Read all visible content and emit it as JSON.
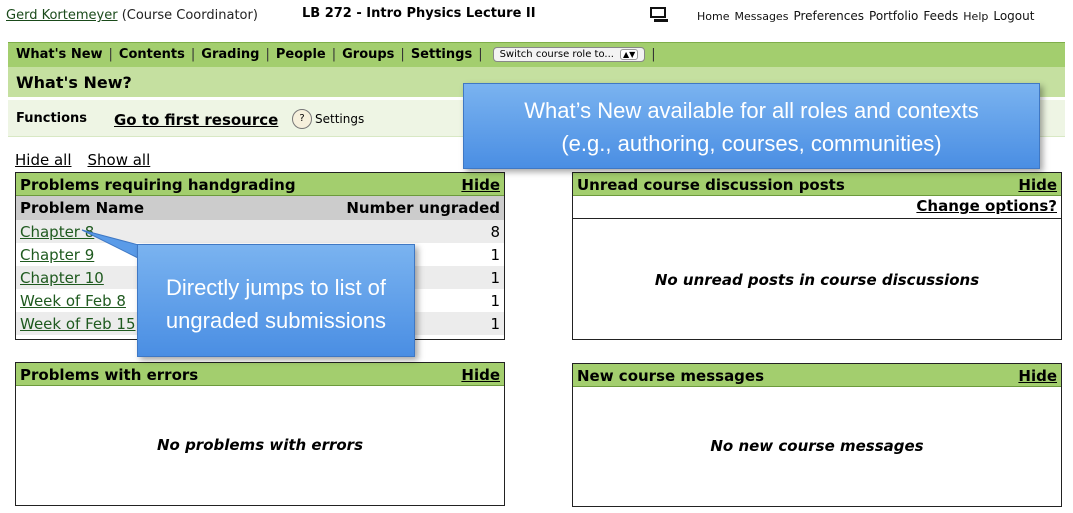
{
  "header": {
    "user_name": "Gerd Kortemeyer",
    "user_role": "(Course Coordinator)",
    "course_title": "LB 272 - Intro Physics Lecture II",
    "links": [
      "Home",
      "Messages",
      "Preferences",
      "Portfolio",
      "Feeds",
      "Help",
      "Logout"
    ]
  },
  "nav": {
    "items": [
      "What's New",
      "Contents",
      "Grading",
      "People",
      "Groups",
      "Settings"
    ],
    "role_select": "Switch course role to..."
  },
  "page_title": "What's New?",
  "functions": {
    "label": "Functions",
    "first_resource": "Go to first resource",
    "settings": "Settings"
  },
  "hide_all": "Hide all",
  "show_all": "Show all",
  "panels": {
    "handgrading": {
      "title": "Problems requiring handgrading",
      "hide": "Hide",
      "col_name": "Problem Name",
      "col_count": "Number ungraded",
      "rows": [
        {
          "name": "Chapter 8",
          "count": "8"
        },
        {
          "name": "Chapter 9",
          "count": "1"
        },
        {
          "name": "Chapter 10",
          "count": "1"
        },
        {
          "name": "Week of Feb 8",
          "count": "1"
        },
        {
          "name": "Week of Feb 15",
          "count": "1"
        }
      ]
    },
    "discussion": {
      "title": "Unread course discussion posts",
      "hide": "Hide",
      "change": "Change options?",
      "empty": "No unread posts in course discussions"
    },
    "errors": {
      "title": "Problems with errors",
      "hide": "Hide",
      "empty": "No problems with errors"
    },
    "messages": {
      "title": "New course messages",
      "hide": "Hide",
      "empty": "No new course messages"
    }
  },
  "callouts": {
    "top_line1": "What’s New available for all roles and contexts",
    "top_line2": "(e.g., authoring, courses, communities)",
    "left_line1": "Directly jumps to list of",
    "left_line2": "ungraded submissions"
  },
  "colors": {
    "nav_green": "#a3ce6e",
    "title_green": "#c5e0a0",
    "callout_blue": "#5a9be8"
  }
}
